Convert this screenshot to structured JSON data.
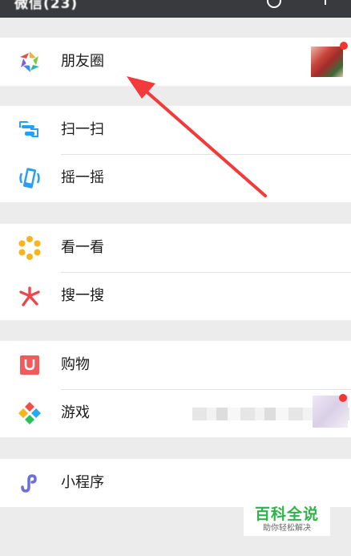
{
  "topbar": {
    "title": "微信(23)"
  },
  "moments": {
    "label": "朋友圈"
  },
  "scan": {
    "label": "扫一扫"
  },
  "shake": {
    "label": "摇一摇"
  },
  "top_stories": {
    "label": "看一看"
  },
  "search": {
    "label": "搜一搜"
  },
  "shopping": {
    "label": "购物"
  },
  "games": {
    "label": "游戏"
  },
  "mini_programs": {
    "label": "小程序"
  },
  "watermark": {
    "title": "百科全说",
    "subtitle": "助你轻松解决"
  },
  "colors": {
    "badge": "#f43530",
    "arrow": "#f23a3a",
    "watermark": "#2fb34a"
  }
}
